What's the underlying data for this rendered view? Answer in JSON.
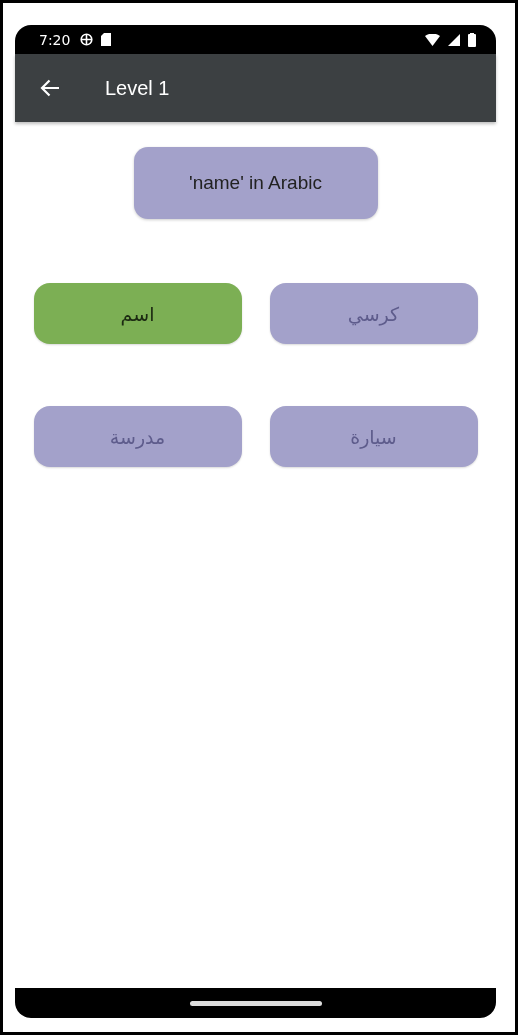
{
  "status_bar": {
    "time": "7:20"
  },
  "app_bar": {
    "title": "Level 1"
  },
  "question": "'name' in Arabic",
  "options": [
    {
      "label": "كرسي",
      "selected": false
    },
    {
      "label": "اسم",
      "selected": true
    },
    {
      "label": "سيارة",
      "selected": false
    },
    {
      "label": "مدرسة",
      "selected": false
    }
  ]
}
